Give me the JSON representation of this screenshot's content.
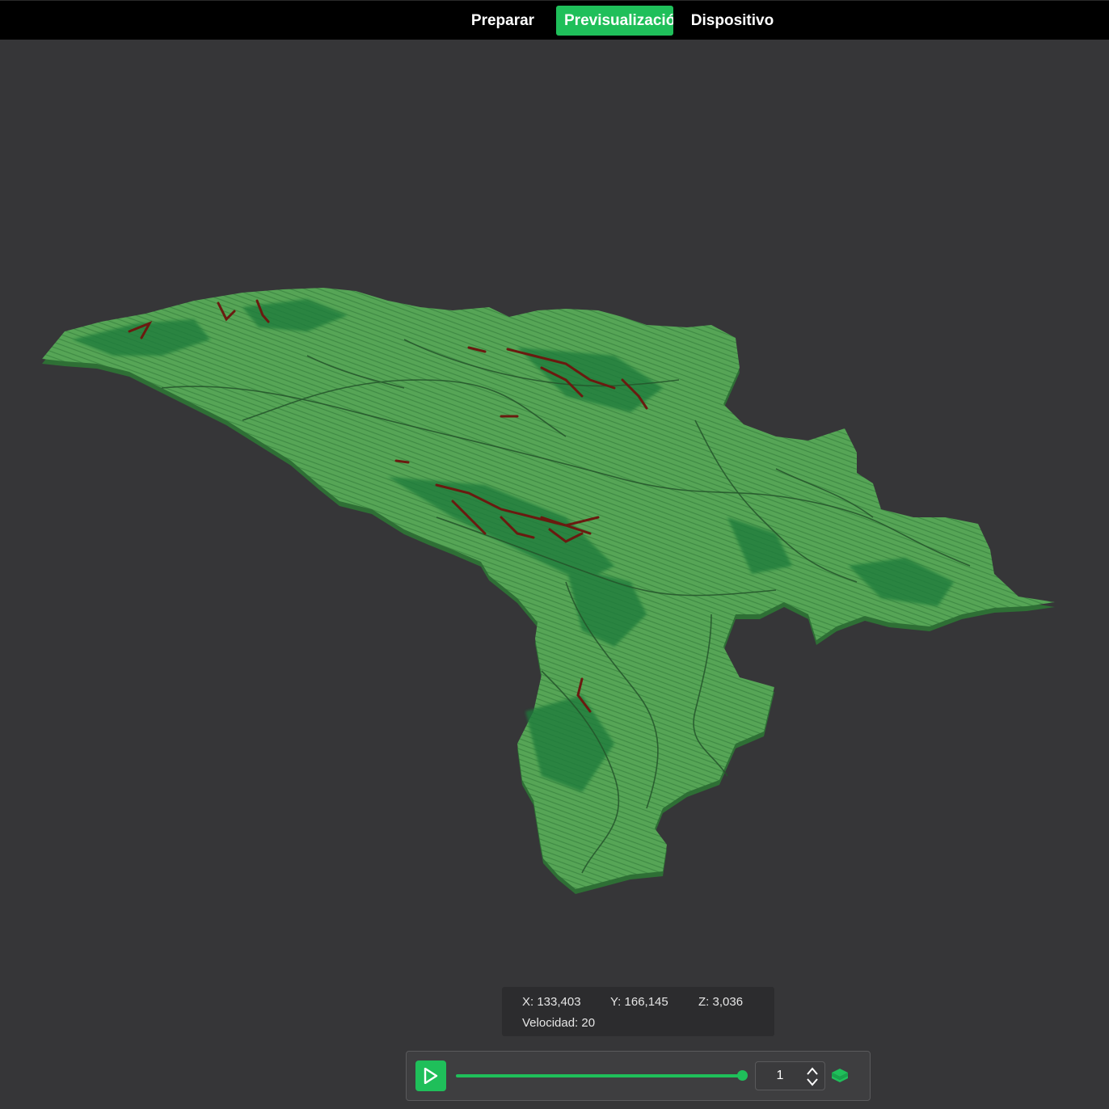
{
  "nav": {
    "tabs": [
      {
        "label": "Preparar",
        "active": false
      },
      {
        "label": "Previsualización",
        "active": true
      },
      {
        "label": "Dispositivo",
        "active": false
      }
    ]
  },
  "coords": {
    "x": "X: 133,403",
    "y": "Y: 166,145",
    "z": "Z: 3,036",
    "speed_label": "Velocidad:",
    "speed_value": "20"
  },
  "playback": {
    "layer_value": "1",
    "progress": 1.0
  },
  "icons": {
    "play": "play-icon",
    "stepper_up": "chevron-up-icon",
    "stepper_down": "chevron-down-icon",
    "layers": "layers-icon"
  },
  "colors": {
    "accent": "#1fbf5a",
    "background": "#363638",
    "terrain": "#4e9a4e",
    "terrain_dark": "#1f7a3a",
    "peaks": "#6a1a10"
  }
}
